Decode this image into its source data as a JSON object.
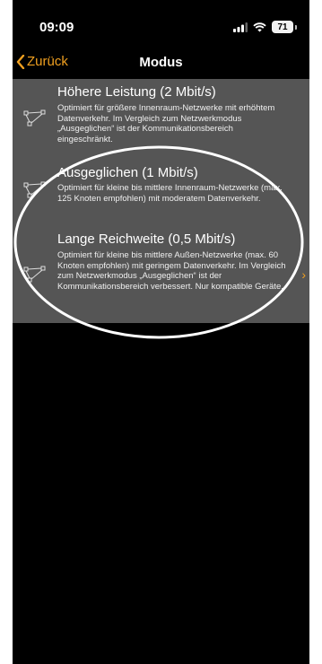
{
  "status_bar": {
    "time": "09:09",
    "battery": "71"
  },
  "nav": {
    "back_label": "Zurück",
    "title": "Modus"
  },
  "options": [
    {
      "title": "Höhere Leistung (2 Mbit/s)",
      "description": "Optimiert für größere Innenraum-Netzwerke mit erhöhtem Datenverkehr. Im Vergleich zum Netzwerkmodus „Ausgeglichen“ ist der Kommunikationsbereich eingeschränkt.",
      "icon": "network-icon"
    },
    {
      "title": "Ausgeglichen (1 Mbit/s)",
      "description": "Optimiert für kleine bis mittlere Innenraum-Netzwerke (max. 125 Knoten empfohlen) mit moderatem Datenverkehr.",
      "icon": "network-icon"
    },
    {
      "title": "Lange Reichweite (0,5 Mbit/s)",
      "description": "Optimiert für kleine bis mittlere Außen-Netzwerke (max. 60 Knoten empfohlen) mit geringem Datenverkehr. Im Vergleich zum Netzwerkmodus „Ausgeglichen“ ist der Kommunikationsbereich verbessert. Nur kompatible Geräte.",
      "icon": "network-icon"
    }
  ],
  "colors": {
    "accent": "#f0a020",
    "panel": "#555555",
    "background": "#000000",
    "annotation": "#ffffff"
  }
}
